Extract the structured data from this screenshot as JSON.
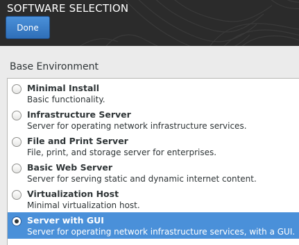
{
  "header": {
    "title": "SOFTWARE SELECTION",
    "done_label": "Done"
  },
  "base_environment": {
    "label": "Base Environment",
    "selected_index": 5,
    "items": [
      {
        "name": "Minimal Install",
        "description": "Basic functionality.",
        "selected": false
      },
      {
        "name": "Infrastructure Server",
        "description": "Server for operating network infrastructure services.",
        "selected": false
      },
      {
        "name": "File and Print Server",
        "description": "File, print, and storage server for enterprises.",
        "selected": false
      },
      {
        "name": "Basic Web Server",
        "description": "Server for serving static and dynamic internet content.",
        "selected": false
      },
      {
        "name": "Virtualization Host",
        "description": "Minimal virtualization host.",
        "selected": false
      },
      {
        "name": "Server with GUI",
        "description": "Server for operating network infrastructure services, with a GUI.",
        "selected": true
      }
    ]
  },
  "colors": {
    "header_bg": "#2b2b2b",
    "accent": "#4a90d9",
    "page_bg": "#ebebeb",
    "text": "#2e3436"
  }
}
